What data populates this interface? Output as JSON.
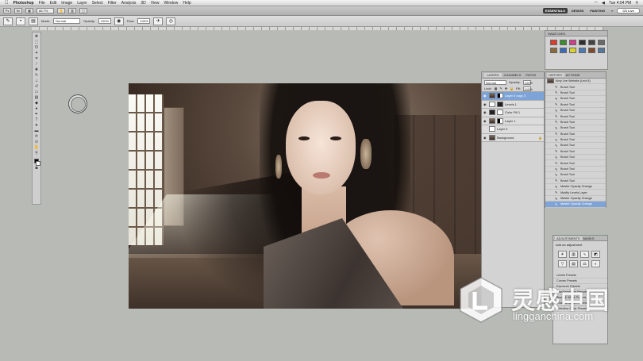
{
  "menubar": {
    "apple": "",
    "app_name": "Photoshop",
    "items": [
      "File",
      "Edit",
      "Image",
      "Layer",
      "Select",
      "Filter",
      "Analysis",
      "3D",
      "View",
      "Window",
      "Help"
    ],
    "clock": "Tue 4:04 PM"
  },
  "appbar": {
    "zoom": "66.7%",
    "workspaces": [
      "ESSENTIALS",
      "DESIGN",
      "PAINTING"
    ],
    "more": "»",
    "cs_live": "CS Live"
  },
  "options": {
    "mode_label": "Mode:",
    "mode_value": "Normal",
    "opacity_label": "Opacity:",
    "opacity_value": "100%",
    "flow_label": "Flow:",
    "flow_value": "100%"
  },
  "swatches": {
    "tab": "SWATCHES",
    "colors": [
      "#e23a2a",
      "#3c8d2f",
      "#d43d8b",
      "#2f2f2f",
      "#444444",
      "#6a6a6a",
      "#8a6a3a",
      "#3a6bb8",
      "#d9d22e",
      "#4a7db5",
      "#7c4a2a",
      "#557799"
    ]
  },
  "layers": {
    "tabs": [
      "LAYERS",
      "CHANNELS",
      "PATHS"
    ],
    "blend": "Normal",
    "opacity_label": "Opacity:",
    "opacity_value": "100%",
    "lock_label": "Lock:",
    "fill_label": "Fill:",
    "fill_value": "100%",
    "rows": [
      {
        "name": "Layer 0 copy 3",
        "active": true
      },
      {
        "name": "Levels 1",
        "active": false
      },
      {
        "name": "Color Fill 1",
        "active": false
      },
      {
        "name": "Layer 1",
        "active": false
      },
      {
        "name": "Layer 0",
        "active": false
      },
      {
        "name": "Background",
        "active": false
      }
    ]
  },
  "history": {
    "tabs": [
      "HISTORY",
      "ACTIONS"
    ],
    "snapshot": "Amy Lee Website (Lect 8)",
    "items": [
      "Brush Tool",
      "Brush Tool",
      "Brush Tool",
      "Brush Tool",
      "Brush Tool",
      "Brush Tool",
      "Brush Tool",
      "Brush Tool",
      "Brush Tool",
      "Brush Tool",
      "Brush Tool",
      "Brush Tool",
      "Brush Tool",
      "Brush Tool",
      "Brush Tool",
      "Brush Tool",
      "Brush Tool",
      "Master Opacity Change",
      "Modify Levels Layer",
      "Master Opacity Change",
      "Master Opacity Change"
    ]
  },
  "adjustments": {
    "tabs": [
      "ADJUSTMENTS",
      "MASKS"
    ],
    "subtitle": "Add an adjustment",
    "list": [
      "Levels Presets",
      "Curves Presets",
      "Exposure Presets",
      "Hue/Saturation Presets",
      "Black & White Presets",
      "Channel Mixer Presets",
      "Selective Color Presets"
    ]
  },
  "watermark": {
    "text_cn": "灵感中国",
    "url": "lingganchina.com"
  },
  "colors": {
    "workspace_bg": "#b7bab5",
    "selection": "#7ea3d6"
  }
}
